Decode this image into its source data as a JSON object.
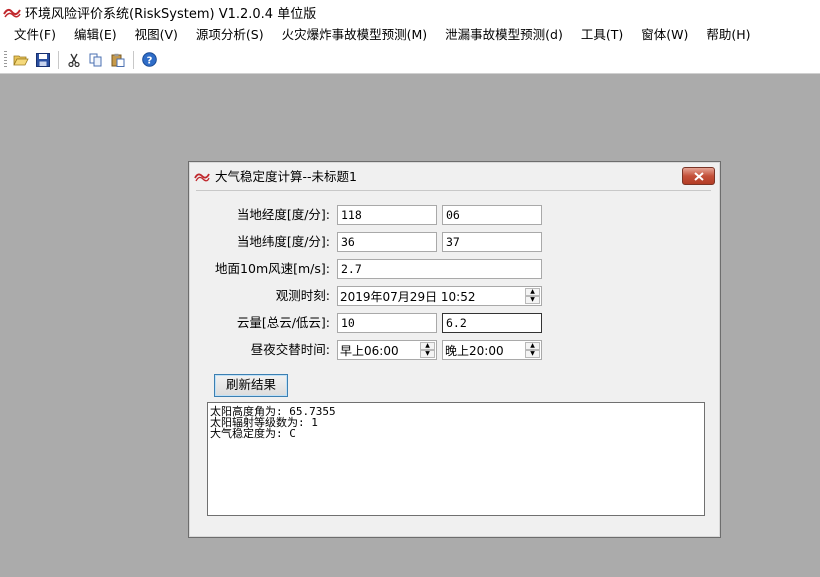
{
  "app": {
    "title": "环境风险评价系统(RiskSystem) V1.2.0.4 单位版"
  },
  "menu": [
    "文件(F)",
    "编辑(E)",
    "视图(V)",
    "源项分析(S)",
    "火灾爆炸事故模型预测(M)",
    "泄漏事故模型预测(d)",
    "工具(T)",
    "窗体(W)",
    "帮助(H)"
  ],
  "toolbar": [
    "open-icon",
    "save-icon",
    "cut-icon",
    "copy-icon",
    "paste-icon",
    "help-icon"
  ],
  "dialog": {
    "title": "大气稳定度计算--未标题1",
    "fields": {
      "longitude_label": "当地经度[度/分]:",
      "longitude_deg": "118",
      "longitude_min": "06",
      "latitude_label": "当地纬度[度/分]:",
      "latitude_deg": "36",
      "latitude_min": "37",
      "wind_label": "地面10m风速[m/s]:",
      "wind_speed": "2.7",
      "obs_time_label": "观测时刻:",
      "obs_time": "2019年07月29日  10:52",
      "cloud_label": "云量[总云/低云]:",
      "cloud_total": "10",
      "cloud_low": "6.2",
      "daynight_label": "昼夜交替时间:",
      "morning_time": "早上06:00",
      "evening_time": "晚上20:00"
    },
    "refresh_button": "刷新结果",
    "results": [
      "太阳高度角为: 65.7355",
      "太阳辐射等级数为: 1",
      "大气稳定度为: C"
    ]
  }
}
